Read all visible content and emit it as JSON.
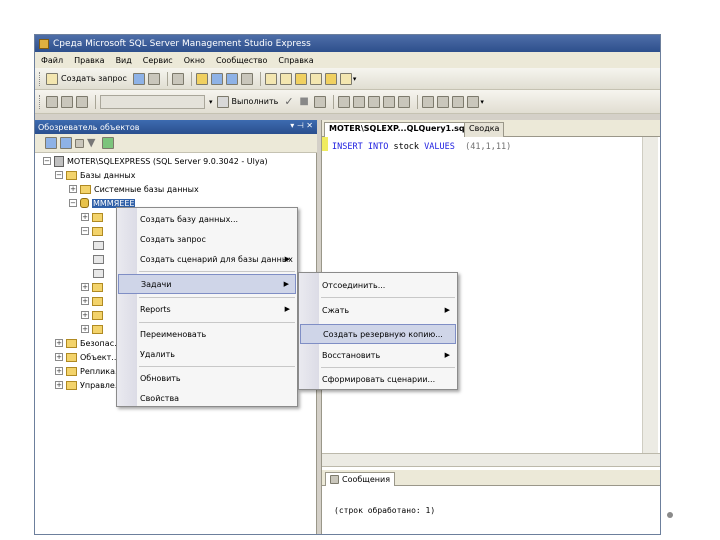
{
  "window": {
    "title": "Среда Microsoft SQL Server Management Studio Express"
  },
  "menubar": [
    "Файл",
    "Правка",
    "Вид",
    "Сервис",
    "Окно",
    "Сообщество",
    "Справка"
  ],
  "toolbar1": {
    "new_query": "Создать запрос"
  },
  "toolbar2": {
    "execute": "Выполнить"
  },
  "object_explorer": {
    "title": "Обозреватель объектов",
    "server": "MOTER\\SQLEXPRESS (SQL Server 9.0.3042 - Ulya)",
    "databases": "Базы данных",
    "system_databases": "Системные базы данных",
    "selected_db": "MMMЯЕЕЕ",
    "security": "Безопас...",
    "server_objects": "Объект...",
    "replication": "Реплика...",
    "management": "Управле..."
  },
  "editor": {
    "tab_title": "MOTER\\SQLEXP...QLQuery1.sql*",
    "tab2_title": "Сводка",
    "code": {
      "kw1": "INSERT",
      "kw2": "INTO",
      "table": "stock",
      "kw3": "VALUES",
      "values": "(41,1,11)"
    }
  },
  "results": {
    "tab_label": "Сообщения",
    "message": "(строк обработано: 1)"
  },
  "context_menu": {
    "items": [
      "Создать базу данных...",
      "Создать запрос",
      "Создать сценарий для базы данных",
      "Задачи",
      "Reports",
      "Переименовать",
      "Удалить",
      "Обновить",
      "Свойства"
    ]
  },
  "submenu": {
    "items": [
      "Отсоединить...",
      "Сжать",
      "Создать резервную копию...",
      "Восстановить",
      "Сформировать сценарии..."
    ]
  }
}
